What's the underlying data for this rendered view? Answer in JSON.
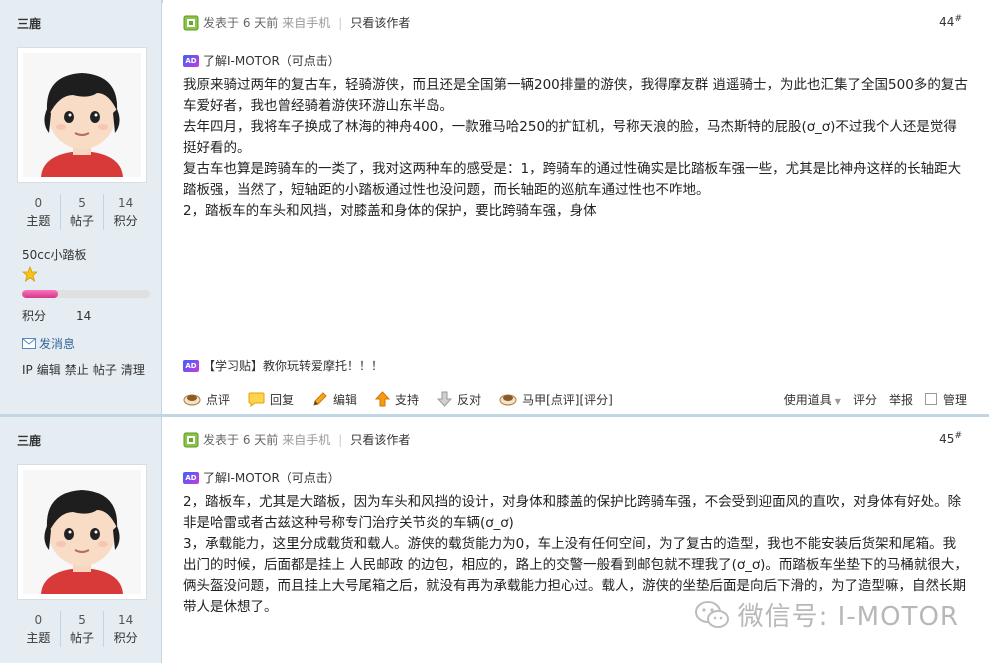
{
  "posts": [
    {
      "author": "三鹿",
      "stats": [
        {
          "num": "0",
          "label": "主题"
        },
        {
          "num": "5",
          "label": "帖子"
        },
        {
          "num": "14",
          "label": "积分"
        }
      ],
      "group": "50cc小踏板",
      "level_progress": 0.28,
      "credit_label": "积分",
      "credit_value": "14",
      "send_msg": "发消息",
      "admin_links": [
        "IP",
        "编辑",
        "禁止",
        "帖子",
        "清理"
      ],
      "posted": "发表于 6 天前",
      "from_mobile": "来自手机",
      "only_author": "只看该作者",
      "floor": "44",
      "floor_sup": "#",
      "ad_text": "了解I-MOTOR（可点击）",
      "paragraphs": [
        "我原来骑过两年的复古车，轻骑游侠，而且还是全国第一辆200排量的游侠，我得摩友群 逍遥骑士，为此也汇集了全国500多的复古车爱好者，我也曾经骑着游侠环游山东半岛。",
        "去年四月，我将车子换成了林海的神舟400，一款雅马哈250的扩缸机，号称天浪的脸，马杰斯特的屁股(ơ_ơ)不过我个人还是觉得挺好看的。",
        "复古车也算是跨骑车的一类了，我对这两种车的感受是：1，跨骑车的通过性确实是比踏板车强一些，尤其是比神舟这样的长轴距大踏板强，当然了，短轴距的小踏板通过性也没问题，而长轴距的巡航车通过性也不咋地。",
        "2，踏板车的车头和风挡，对膝盖和身体的保护，要比跨骑车强，身体"
      ],
      "ad2_text": "【学习贴】教你玩转爱摩托！！！",
      "actions": [
        "点评",
        "回复",
        "编辑",
        "支持",
        "反对",
        "马甲[点评][评分]"
      ],
      "actions_right": [
        "使用道具",
        "评分",
        "举报",
        "管理"
      ]
    },
    {
      "author": "三鹿",
      "stats": [
        {
          "num": "0",
          "label": "主题"
        },
        {
          "num": "5",
          "label": "帖子"
        },
        {
          "num": "14",
          "label": "积分"
        }
      ],
      "posted": "发表于 6 天前",
      "from_mobile": "来自手机",
      "only_author": "只看该作者",
      "floor": "45",
      "floor_sup": "#",
      "ad_text": "了解I-MOTOR（可点击）",
      "paragraphs": [
        "2，踏板车，尤其是大踏板，因为车头和风挡的设计，对身体和膝盖的保护比跨骑车强，不会受到迎面风的直吹，对身体有好处。除非是哈雷或者古兹这种号称专门治疗关节炎的车辆(ơ_ơ)",
        "3，承载能力，这里分成载货和载人。游侠的载货能力为0，车上没有任何空间，为了复古的造型，我也不能安装后货架和尾箱。我出门的时候，后面都是挂上 人民邮政 的边包，相应的，路上的交警一般看到邮包就不理我了(ơ_ơ)。而踏板车坐垫下的马桶就很大，俩头盔没问题，而且挂上大号尾箱之后，就没有再为承载能力担心过。载人，游侠的坐垫后面是向后下滑的，为了造型嘛，自然长期带人是休想了。"
      ]
    }
  ],
  "watermark": "微信号: I-MOTOR",
  "colors": {
    "sidebar_bg": "#e5edf2",
    "border": "#c2d5e3",
    "link": "#336699",
    "level_bar": "#e0489c"
  }
}
